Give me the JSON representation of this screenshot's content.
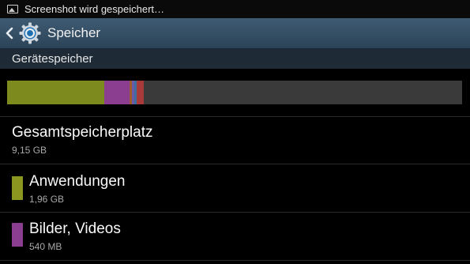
{
  "status_bar": {
    "notification_icon": "image-icon",
    "text": "Screenshot wird gespeichert…"
  },
  "action_bar": {
    "back_icon": "chevron-left-icon",
    "app_icon": "gear-icon",
    "title": "Speicher"
  },
  "section": {
    "title": "Gerätespeicher"
  },
  "usage_bar": {
    "segments": [
      {
        "name": "Anwendungen",
        "color": "#7d8a1e",
        "fraction": 0.214
      },
      {
        "name": "Bilder, Videos",
        "color": "#8b3d8f",
        "fraction": 0.056
      },
      {
        "name": "segment-3",
        "color": "#a05a2c",
        "fraction": 0.005
      },
      {
        "name": "segment-4",
        "color": "#6a5aa8",
        "fraction": 0.005
      },
      {
        "name": "segment-5",
        "color": "#3c6fa0",
        "fraction": 0.006
      },
      {
        "name": "segment-6",
        "color": "#a83a3a",
        "fraction": 0.016
      }
    ],
    "empty_color": "#3a3a3a"
  },
  "total": {
    "label": "Gesamtspeicherplatz",
    "value": "9,15 GB"
  },
  "items": [
    {
      "label": "Anwendungen",
      "value": "1,96 GB",
      "color": "#8a961f"
    },
    {
      "label": "Bilder, Videos",
      "value": "540 MB",
      "color": "#8b3d8f"
    }
  ]
}
